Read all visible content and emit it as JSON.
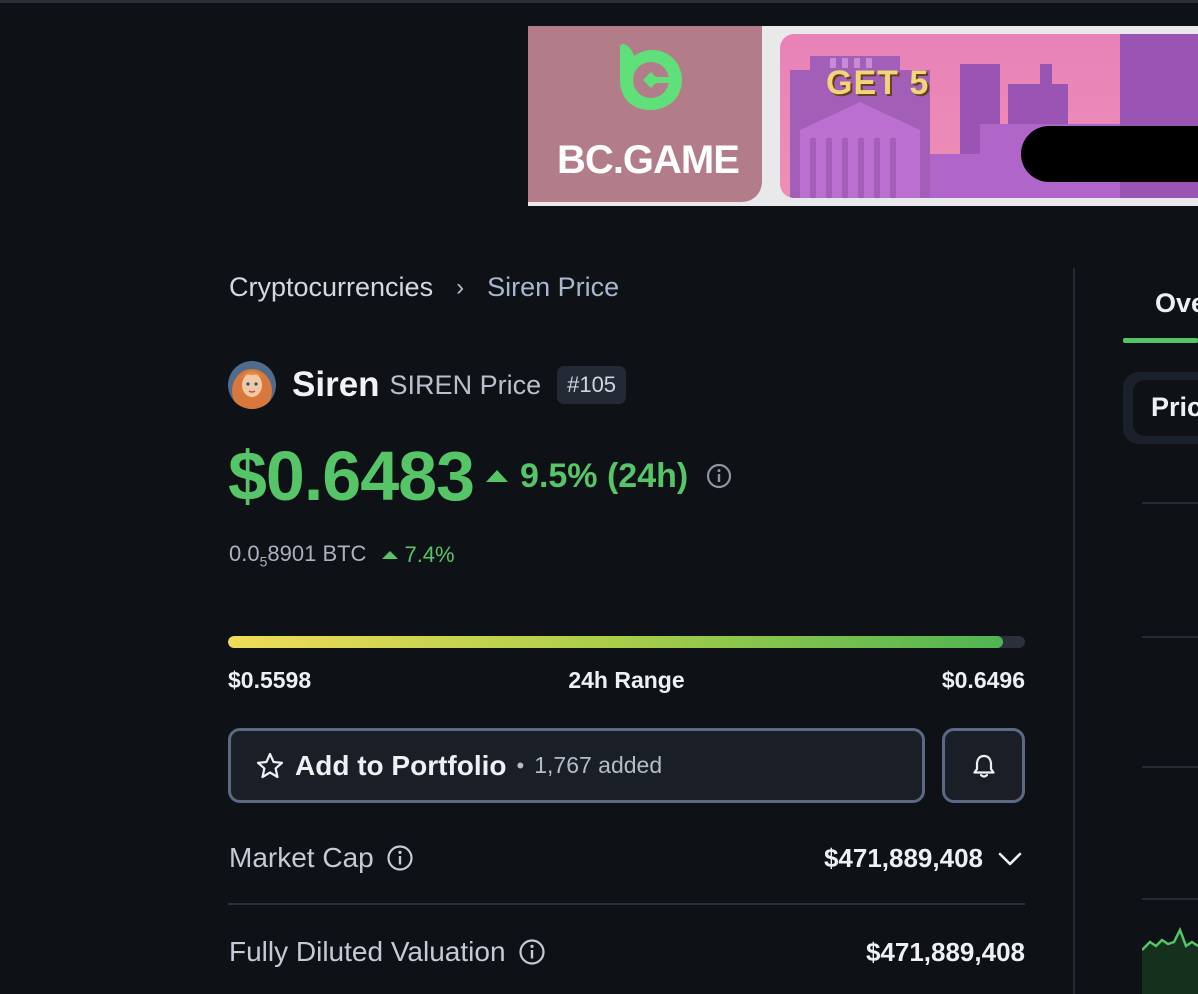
{
  "ad": {
    "brand": "BC.GAME",
    "headline": "GET 5",
    "colors": {
      "logo_bg": "#b27d89",
      "mark": "#5fe07a",
      "art_bg": "#ec89b6",
      "headline": "#f0d67a"
    }
  },
  "breadcrumb": {
    "root": "Cryptocurrencies",
    "separator": "›",
    "current": "Siren Price"
  },
  "coin": {
    "name": "Siren",
    "subtitle": "SIREN Price",
    "rank": "#105"
  },
  "price": {
    "value": "$0.6483",
    "change_24h": "9.5% (24h)",
    "direction": "up",
    "btc_value_prefix": "0.0",
    "btc_value_subscript": "5",
    "btc_value_suffix": "8901 BTC",
    "btc_change": "7.4%"
  },
  "range_24h": {
    "low": "$0.5598",
    "label": "24h Range",
    "high": "$0.6496",
    "current_fraction": 0.972
  },
  "portfolio": {
    "button_label": "Add to Portfolio",
    "dot": "•",
    "count_label": "1,767 added"
  },
  "stats": {
    "market_cap": {
      "label": "Market Cap",
      "value": "$471,889,408"
    },
    "fdv": {
      "label": "Fully Diluted Valuation",
      "value": "$471,889,408"
    }
  },
  "right_panel": {
    "tab_label": "Ove",
    "pill_label": "Pric"
  },
  "colors": {
    "background": "#0e1116",
    "positive": "#55c568",
    "muted": "#aab2bf",
    "border": "#5a6a84"
  }
}
